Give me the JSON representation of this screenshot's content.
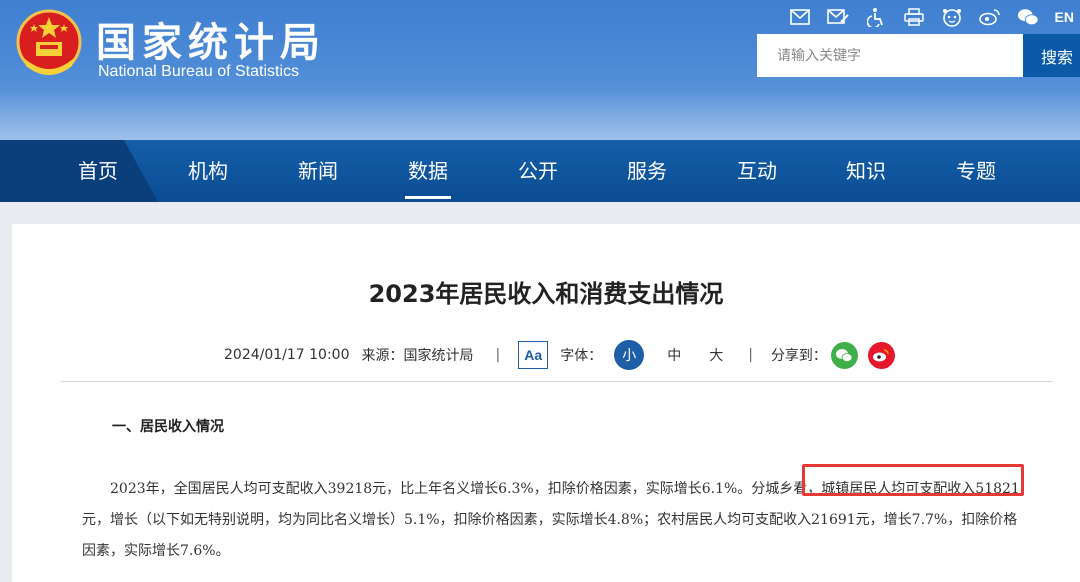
{
  "header": {
    "title": "国家统计局",
    "subtitle": "National Bureau of Statistics",
    "top_icons": [
      "mail-icon",
      "mail-edit-icon",
      "accessibility-icon",
      "printer-icon",
      "robot-icon",
      "weibo-icon",
      "wechat-icon"
    ],
    "lang_label": "EN",
    "search": {
      "placeholder": "请输入关键字",
      "button_label": "搜索"
    }
  },
  "nav": {
    "items": [
      {
        "label": "首页"
      },
      {
        "label": "机构"
      },
      {
        "label": "新闻"
      },
      {
        "label": "数据",
        "active": true
      },
      {
        "label": "公开"
      },
      {
        "label": "服务"
      },
      {
        "label": "互动"
      },
      {
        "label": "知识"
      },
      {
        "label": "专题"
      }
    ]
  },
  "article": {
    "title": "2023年居民收入和消费支出情况",
    "date": "2024/01/17 10:00",
    "source_label": "来源：国家统计局",
    "separator": "|",
    "aa_label": "Aa",
    "font_label": "字体：",
    "font_sizes": [
      "小",
      "中",
      "大"
    ],
    "share_label": "分享到：",
    "section_heading": "一、居民收入情况",
    "paragraph_lines": [
      "2023年，全国居民人均可支配收入39218元，比上年名义增长6.3%，扣除价格因素，实际增长6.1%。分城乡看，城镇居民人均可支配收入51821",
      "元，增长（以下如无特别说明，均为同比名义增长）5.1%，扣除价格因素，实际增长4.8%；农村居民人均可支配收入21691元，增长7.7%，扣除价格",
      "因素，实际增长7.6%。"
    ],
    "highlighted_text": "城镇居民人均可支配收入51821"
  },
  "colors": {
    "header_blue": "#4c8ad6",
    "nav_blue": "#0b4c93",
    "accent_blue": "#1d5ea6",
    "highlight_red": "#e53935",
    "wechat_green": "#3fb049",
    "weibo_red": "#e6162d"
  }
}
